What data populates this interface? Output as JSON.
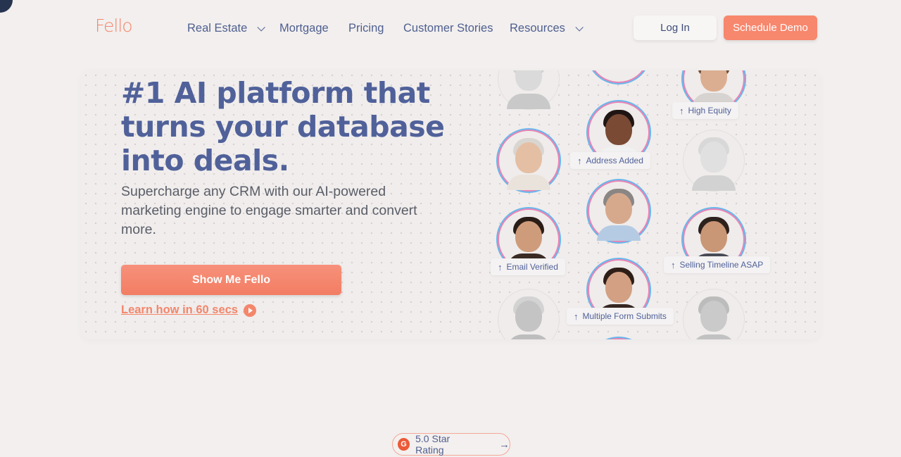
{
  "brand": {
    "logo": "Fello",
    "accent": "#f3866b",
    "primary_text": "#50619a"
  },
  "nav": {
    "items": [
      {
        "label": "Real Estate",
        "dropdown": true
      },
      {
        "label": "Mortgage",
        "dropdown": false
      },
      {
        "label": "Pricing",
        "dropdown": false
      },
      {
        "label": "Customer Stories",
        "dropdown": false
      },
      {
        "label": "Resources",
        "dropdown": true
      }
    ],
    "login_label": "Log In",
    "demo_label": "Schedule  Demo"
  },
  "hero": {
    "headline": "#1 AI platform that turns your database into deals.",
    "subheadline": "Supercharge any CRM with our AI-powered marketing engine to engage smarter and convert more.",
    "cta_label": "Show Me Fello",
    "learn_label": "Learn how in 60 secs"
  },
  "signals": {
    "high_equity": "High Equity",
    "address_added": "Address Added",
    "email_verified": "Email Verified",
    "selling_timeline": "Selling Timeline ASAP",
    "multiple_forms": "Multiple Form Submits"
  },
  "rating": {
    "badge": "G",
    "label": "5.0 Star Rating"
  }
}
